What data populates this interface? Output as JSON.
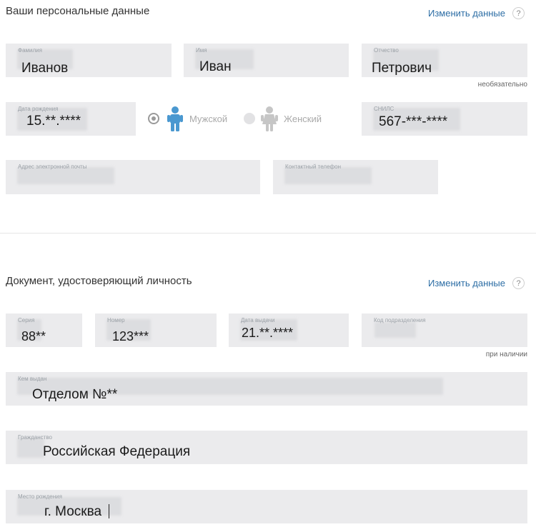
{
  "personal": {
    "title": "Ваши персональные данные",
    "edit_label": "Изменить данные",
    "help_label": "?",
    "surname": {
      "label": "Фамилия",
      "value": "Иванов"
    },
    "name": {
      "label": "Имя",
      "value": "Иван"
    },
    "patronymic": {
      "label": "Отчество",
      "value": "Петрович",
      "hint": "необязательно"
    },
    "birth_date": {
      "label": "Дата рождения",
      "value": "15.**.****"
    },
    "gender": {
      "male_label": "Мужской",
      "female_label": "Женский",
      "selected": "male"
    },
    "snils": {
      "label": "СНИЛС",
      "value": "567-***-****"
    },
    "email": {
      "label": "Адрес электронной почты",
      "value": ""
    },
    "phone": {
      "label": "Контактный телефон",
      "value": ""
    }
  },
  "document": {
    "title": "Документ, удостоверяющий личность",
    "edit_label": "Изменить данные",
    "help_label": "?",
    "series": {
      "label": "Серия",
      "value": "88**"
    },
    "number": {
      "label": "Номер",
      "value": "123***"
    },
    "issue_date": {
      "label": "Дата выдачи",
      "value": "21.**.****"
    },
    "division_code": {
      "label": "Код подразделения",
      "value": "",
      "hint": "при наличии"
    },
    "issued_by": {
      "label": "Кем выдан",
      "value": "Отделом №**"
    },
    "citizenship": {
      "label": "Гражданство",
      "value": "Российская Федерация"
    },
    "birth_place": {
      "label": "Место рождения",
      "value": "г. Москва"
    }
  },
  "colors": {
    "link": "#2d6ea5",
    "field_bg": "#ebebed",
    "person_icon_active": "#4a98d0",
    "person_icon_inactive": "#c6c6c6"
  },
  "icons": {
    "male": "male-person-icon",
    "female": "female-person-icon"
  }
}
